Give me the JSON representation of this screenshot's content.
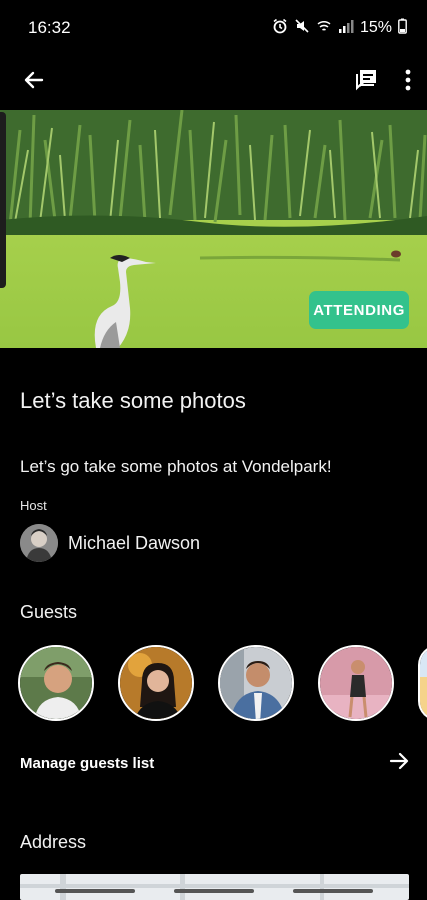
{
  "status_bar": {
    "time": "16:32",
    "icons": [
      "alarm-icon",
      "mute-icon",
      "wifi-calling-icon",
      "signal-icon"
    ],
    "battery": "15%"
  },
  "app_bar": {
    "back_icon": "arrow-left-icon",
    "chat_icon": "chat-icon",
    "more_icon": "more-vertical-icon"
  },
  "event": {
    "status_badge": "ATTENDING",
    "title": "Let’s take some photos",
    "description": "Let’s go take some photos at Vondelpark!",
    "host_label": "Host",
    "host_name": "Michael Dawson",
    "guests_label": "Guests",
    "manage_guests_label": "Manage guests list",
    "address_label": "Address"
  },
  "colors": {
    "background": "#000000",
    "accent": "#33c28c",
    "text": "#f2f2f2"
  }
}
